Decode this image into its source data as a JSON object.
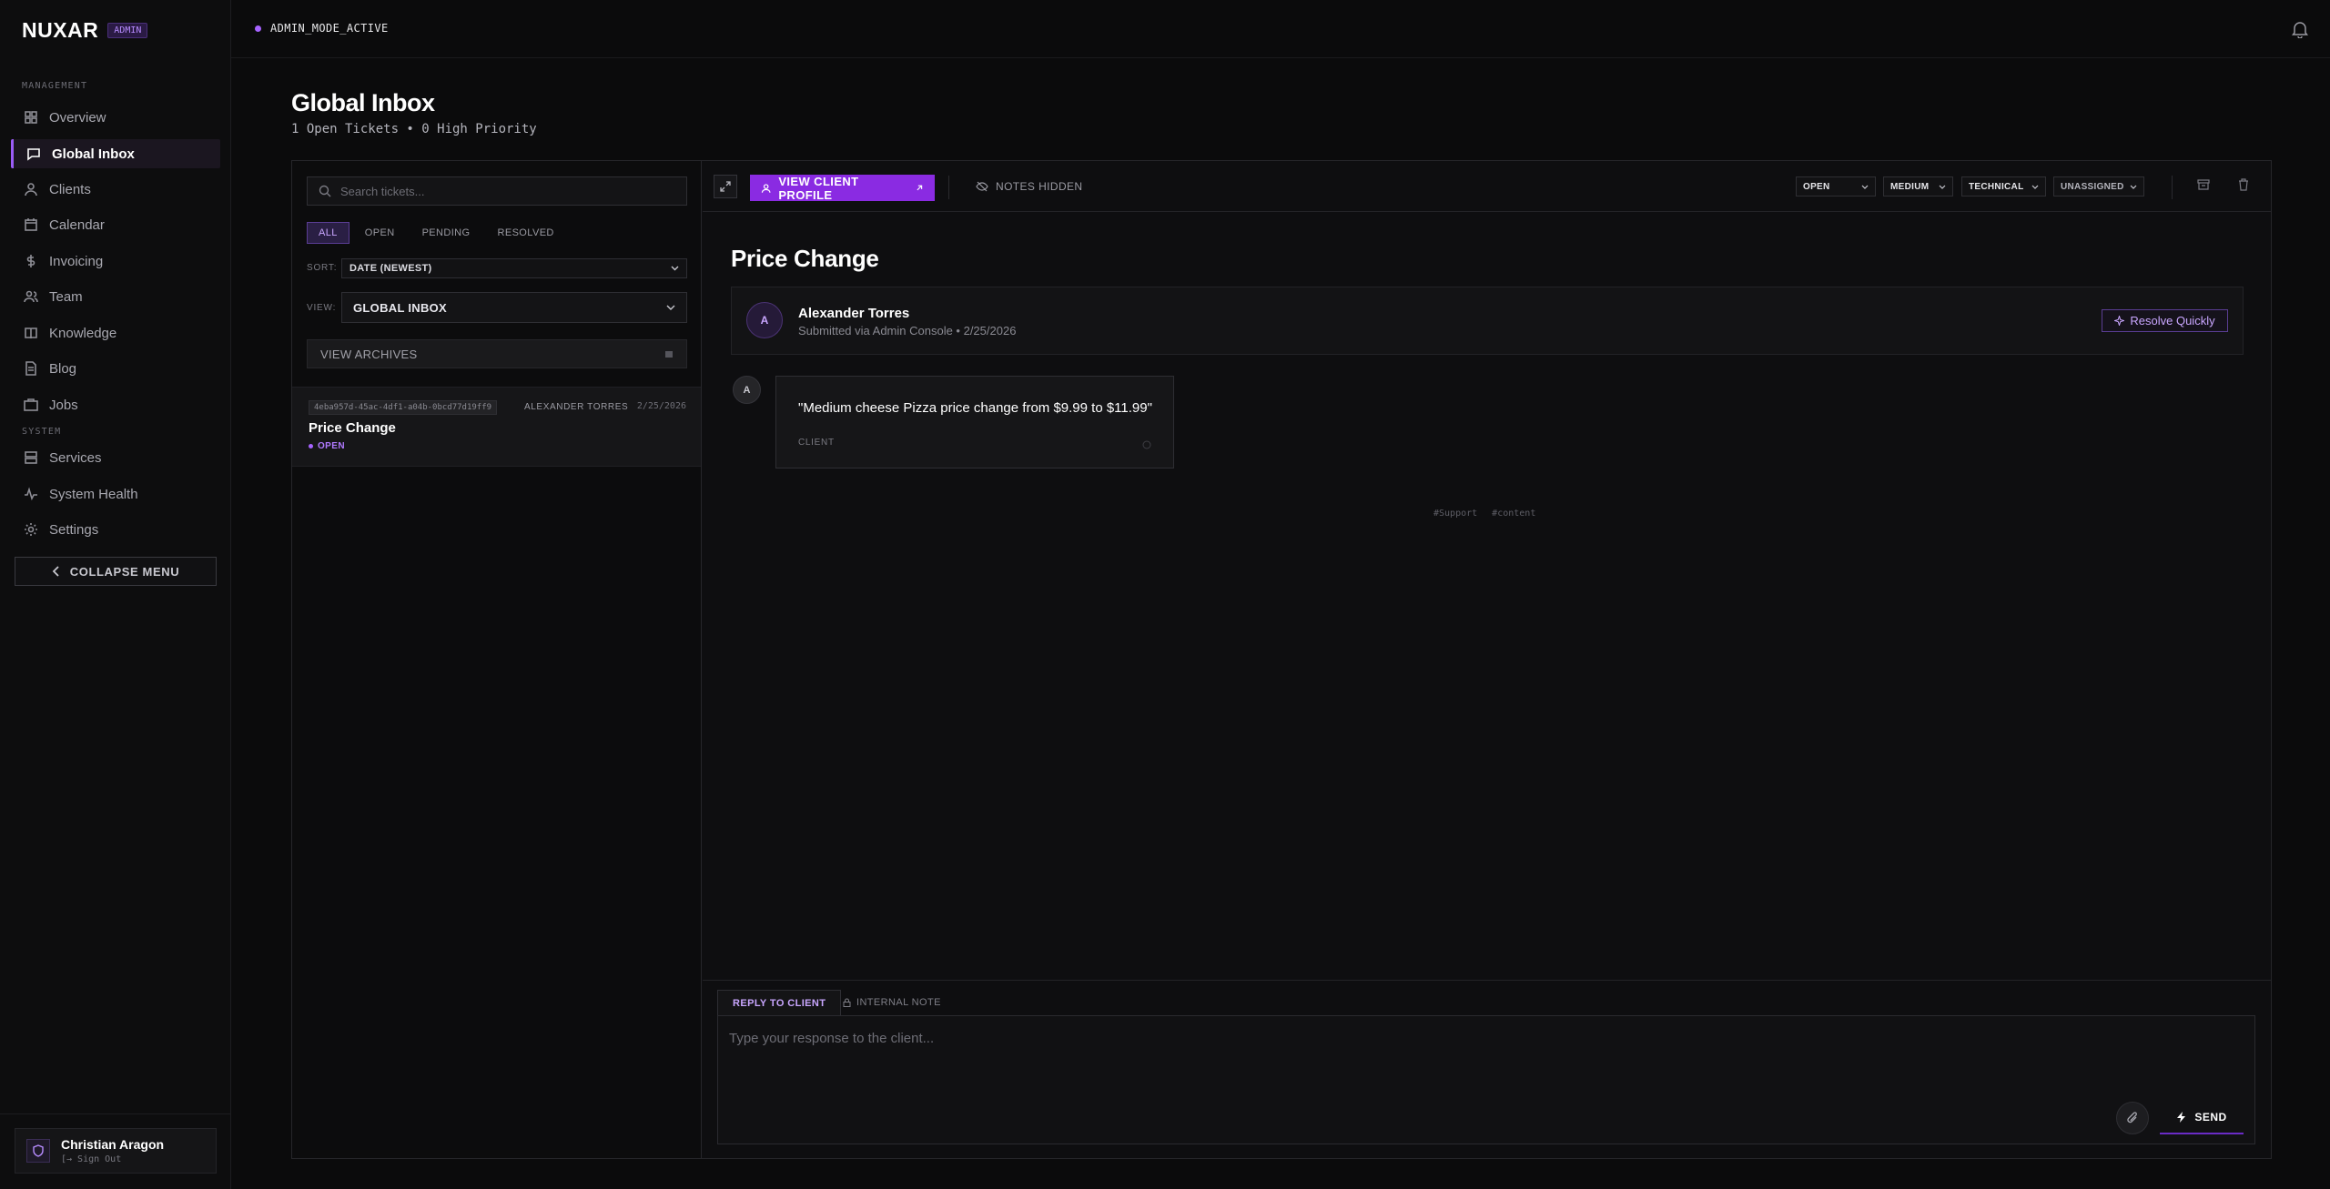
{
  "brand": {
    "logo": "NUXAR",
    "badge": "ADMIN"
  },
  "topbar": {
    "mode": "ADMIN_MODE_ACTIVE"
  },
  "sidebar": {
    "section_management": "MANAGEMENT",
    "section_system": "SYSTEM",
    "items": [
      {
        "label": "Overview",
        "icon": "grid-icon"
      },
      {
        "label": "Global Inbox",
        "icon": "message-icon",
        "active": true
      },
      {
        "label": "Clients",
        "icon": "user-icon"
      },
      {
        "label": "Calendar",
        "icon": "calendar-icon"
      },
      {
        "label": "Invoicing",
        "icon": "dollar-icon"
      },
      {
        "label": "Team",
        "icon": "users-icon"
      },
      {
        "label": "Knowledge",
        "icon": "book-icon"
      },
      {
        "label": "Blog",
        "icon": "document-icon"
      },
      {
        "label": "Jobs",
        "icon": "briefcase-icon"
      },
      {
        "label": "Services",
        "icon": "server-icon"
      },
      {
        "label": "System Health",
        "icon": "activity-icon"
      },
      {
        "label": "Settings",
        "icon": "gear-icon"
      }
    ],
    "collapse_label": "COLLAPSE MENU",
    "user": {
      "name": "Christian Aragon",
      "sub": "[→ Sign Out"
    }
  },
  "header": {
    "title": "Global Inbox",
    "subtitle": "1 Open Tickets • 0 High Priority"
  },
  "list": {
    "search_placeholder": "Search tickets...",
    "filters": [
      "ALL",
      "OPEN",
      "PENDING",
      "RESOLVED"
    ],
    "sort_label": "SORT:",
    "sort_value": "DATE (NEWEST)",
    "view_label": "VIEW:",
    "view_value": "GLOBAL INBOX",
    "archives_label": "VIEW ARCHIVES",
    "tickets": [
      {
        "id": "4eba957d-45ac-4df1-a04b-0bcd77d19ff9",
        "author": "ALEXANDER TORRES",
        "date": "2/25/2026",
        "title": "Price Change",
        "status": "OPEN"
      }
    ]
  },
  "detail": {
    "view_profile_label": "VIEW CLIENT PROFILE",
    "notes_hidden_label": "NOTES HIDDEN",
    "dropdowns": {
      "status": "OPEN",
      "priority": "MEDIUM",
      "category": "TECHNICAL",
      "assignee": "UNASSIGNED"
    },
    "title": "Price Change",
    "submitter": {
      "initial": "A",
      "name": "Alexander Torres",
      "meta": "Submitted via Admin Console • 2/25/2026",
      "resolve_label": "Resolve Quickly"
    },
    "message": {
      "initial": "A",
      "text": "\"Medium cheese Pizza price change from $9.99 to $11.99\"",
      "role": "CLIENT"
    },
    "tags": [
      "#Support",
      "#content"
    ],
    "reply": {
      "tab_reply": "REPLY TO CLIENT",
      "tab_note": "INTERNAL NOTE",
      "placeholder": "Type your response to the client...",
      "send_label": "SEND"
    }
  },
  "colors": {
    "accent": "#8a2be2",
    "accent_light": "#c9a6ff",
    "background": "#0b0b0c"
  }
}
